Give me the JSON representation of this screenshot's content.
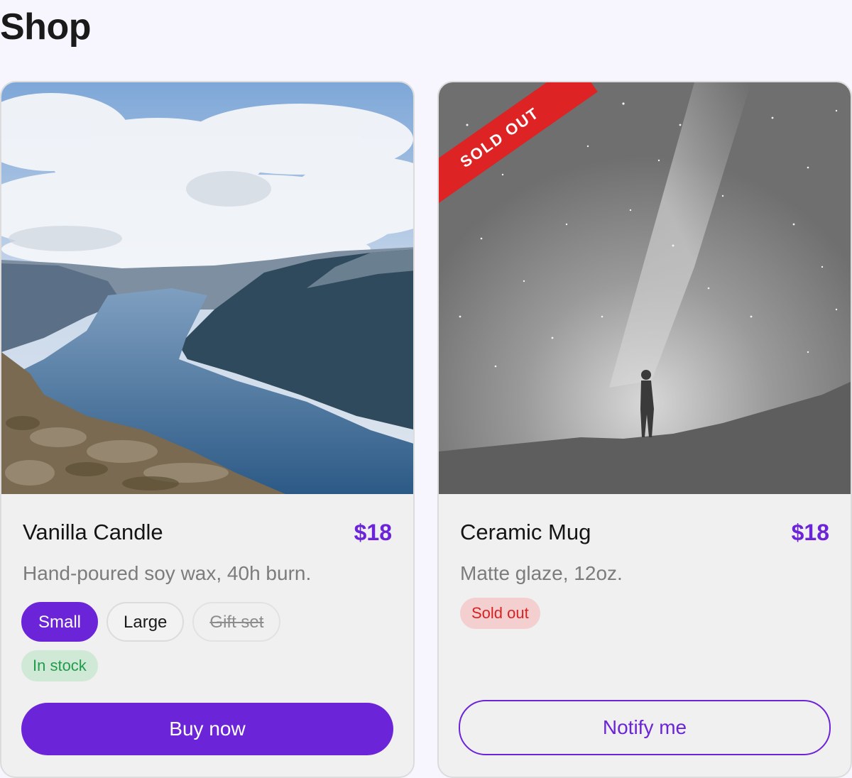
{
  "page": {
    "title": "Shop"
  },
  "products": [
    {
      "name": "Vanilla Candle",
      "price": "$18",
      "description": "Hand-poured soy wax, 40h burn.",
      "image": "fjord-landscape-photo",
      "options": [
        {
          "label": "Small",
          "state": "selected"
        },
        {
          "label": "Large",
          "state": "available"
        },
        {
          "label": "Gift set",
          "state": "unavailable"
        }
      ],
      "stock_badge": "In stock",
      "cta": "Buy now"
    },
    {
      "name": "Ceramic Mug",
      "price": "$18",
      "description": "Matte glaze, 12oz.",
      "image": "night-sky-silhouette-photo",
      "ribbon": "SOLD OUT",
      "stock_badge": "Sold out",
      "cta": "Notify me"
    }
  ],
  "colors": {
    "accent": "#6c24d8",
    "in_stock_bg": "#cfe9d6",
    "in_stock_text": "#1f9d4a",
    "sold_out": "#dd2323",
    "sold_out_badge_bg": "#f3cfcf"
  }
}
